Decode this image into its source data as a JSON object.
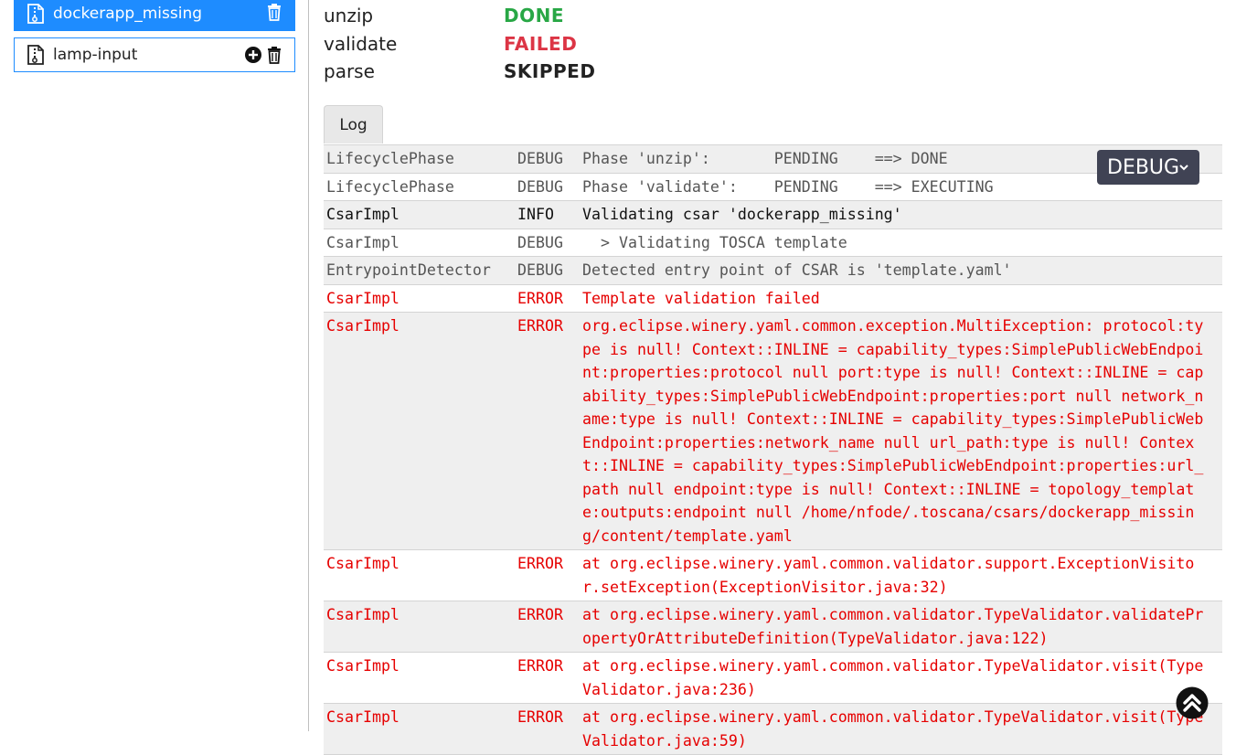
{
  "sidebar": {
    "items": [
      {
        "label": "dockerapp_missing",
        "active": true
      },
      {
        "label": "lamp-input",
        "active": false
      }
    ]
  },
  "phases": [
    {
      "name": "unzip",
      "status": "DONE",
      "color": "#28a745"
    },
    {
      "name": "validate",
      "status": "FAILED",
      "color": "#dc3545"
    },
    {
      "name": "parse",
      "status": "SKIPPED",
      "color": "#222222"
    }
  ],
  "tabs": {
    "log_label": "Log"
  },
  "log_level_select": {
    "value": "DEBUG"
  },
  "log": [
    {
      "source": "LifecyclePhase",
      "level": "DEBUG",
      "message": "Phase 'unzip':       PENDING    ==> DONE"
    },
    {
      "source": "LifecyclePhase",
      "level": "DEBUG",
      "message": "Phase 'validate':    PENDING    ==> EXECUTING"
    },
    {
      "source": "CsarImpl",
      "level": "INFO",
      "message": "Validating csar 'dockerapp_missing'"
    },
    {
      "source": "CsarImpl",
      "level": "DEBUG",
      "message": "  > Validating TOSCA template"
    },
    {
      "source": "EntrypointDetector",
      "level": "DEBUG",
      "message": "Detected entry point of CSAR is 'template.yaml'"
    },
    {
      "source": "CsarImpl",
      "level": "ERROR",
      "message": "Template validation failed"
    },
    {
      "source": "CsarImpl",
      "level": "ERROR",
      "message": "org.eclipse.winery.yaml.common.exception.MultiException: protocol:type is null! Context::INLINE = capability_types:SimplePublicWebEndpoint:properties:protocol null port:type is null! Context::INLINE = capability_types:SimplePublicWebEndpoint:properties:port null network_name:type is null! Context::INLINE = capability_types:SimplePublicWebEndpoint:properties:network_name null url_path:type is null! Context::INLINE = capability_types:SimplePublicWebEndpoint:properties:url_path null endpoint:type is null! Context::INLINE = topology_template:outputs:endpoint null /home/nfode/.toscana/csars/dockerapp_missing/content/template.yaml"
    },
    {
      "source": "CsarImpl",
      "level": "ERROR",
      "message": "at org.eclipse.winery.yaml.common.validator.support.ExceptionVisitor.setException(ExceptionVisitor.java:32)"
    },
    {
      "source": "CsarImpl",
      "level": "ERROR",
      "message": "at org.eclipse.winery.yaml.common.validator.TypeValidator.validatePropertyOrAttributeDefinition(TypeValidator.java:122)"
    },
    {
      "source": "CsarImpl",
      "level": "ERROR",
      "message": "at org.eclipse.winery.yaml.common.validator.TypeValidator.visit(TypeValidator.java:236)"
    },
    {
      "source": "CsarImpl",
      "level": "ERROR",
      "message": "at org.eclipse.winery.yaml.common.validator.TypeValidator.visit(TypeValidator.java:59)"
    }
  ]
}
